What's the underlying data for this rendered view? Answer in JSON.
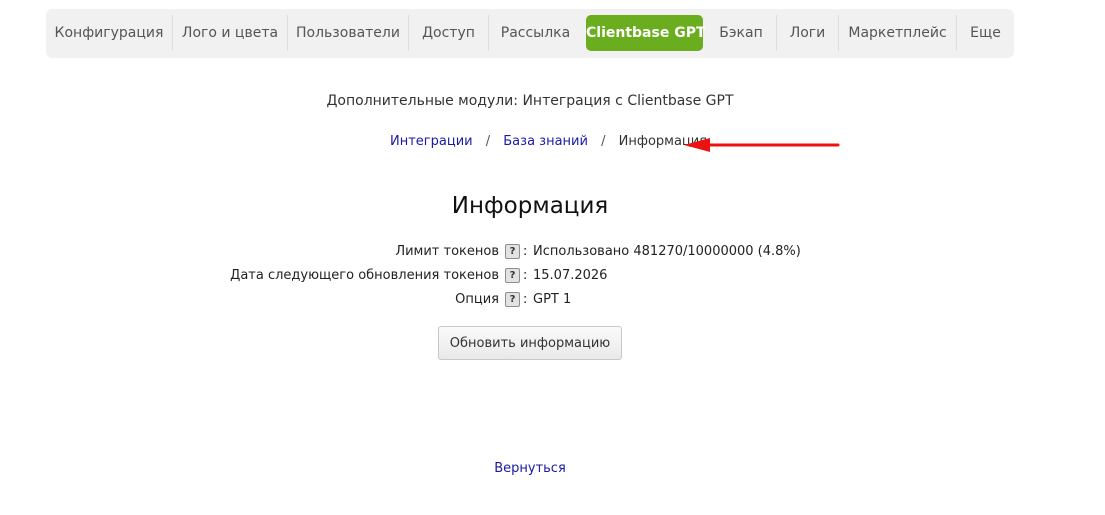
{
  "nav": {
    "tabs": [
      {
        "label": "Конфигурация"
      },
      {
        "label": "Лого и цвета"
      },
      {
        "label": "Пользователи"
      },
      {
        "label": "Доступ"
      },
      {
        "label": "Рассылка"
      },
      {
        "label": "Clientbase GPT",
        "active": true
      },
      {
        "label": "Бэкап"
      },
      {
        "label": "Логи"
      },
      {
        "label": "Маркетплейс"
      },
      {
        "label": "Еще"
      }
    ]
  },
  "subtitle": "Дополнительные модули: Интеграция с Clientbase GPT",
  "breadcrumb": {
    "items": [
      "Интеграции",
      "База знаний"
    ],
    "current": "Информация",
    "separator": "/"
  },
  "heading": "Информация",
  "info": {
    "rows": [
      {
        "label": "Лимит токенов",
        "value": "Использовано 481270/10000000 (4.8%)"
      },
      {
        "label": "Дата следующего обновления токенов",
        "value": "15.07.2026"
      },
      {
        "label": "Опция",
        "value": "GPT 1"
      }
    ],
    "help_glyph": "?",
    "colon": ":"
  },
  "refresh_button": "Обновить информацию",
  "back_link": "Вернуться",
  "colors": {
    "accent": "#6aae1f",
    "link": "#1a1aa6",
    "arrow": "#ee1111"
  }
}
